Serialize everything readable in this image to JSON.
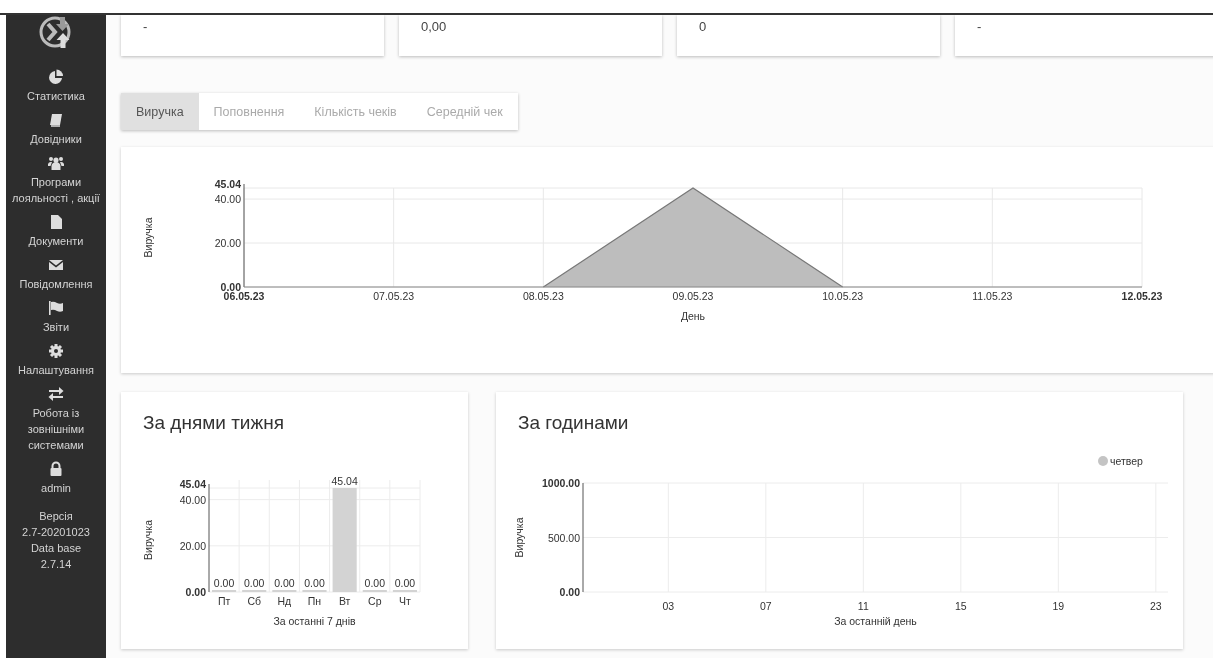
{
  "sidebar": {
    "items": [
      {
        "label": "Статистика"
      },
      {
        "label": "Довідники"
      },
      {
        "label": "Програми лояльності , акції"
      },
      {
        "label": "Документи"
      },
      {
        "label": "Повідомлення"
      },
      {
        "label": "Звіти"
      },
      {
        "label": "Налаштування"
      },
      {
        "label": "Робота із зовнішніми системами"
      },
      {
        "label": "admin"
      }
    ],
    "version_lines": [
      "Версія",
      "2.7-20201023",
      "Data base",
      "2.7.14"
    ]
  },
  "summary_cards": [
    {
      "value": "-"
    },
    {
      "value": "0,00"
    },
    {
      "value": "0"
    },
    {
      "value": "-"
    }
  ],
  "tabs": [
    {
      "label": "Виручка",
      "selected": true
    },
    {
      "label": "Поповнення",
      "selected": false
    },
    {
      "label": "Кількість чеків",
      "selected": false
    },
    {
      "label": "Середній чек",
      "selected": false
    }
  ],
  "revenue_chart": {
    "chart_data": {
      "type": "area",
      "xlabel": "День",
      "ylabel": "Виручка",
      "categories": [
        "06.05.23",
        "07.05.23",
        "08.05.23",
        "09.05.23",
        "10.05.23",
        "11.05.23",
        "12.05.23"
      ],
      "series": [
        {
          "color": "#bdbdbd",
          "values": [
            null,
            null,
            0,
            45.04,
            0,
            null,
            null
          ]
        }
      ],
      "grid": true,
      "ylim": [
        0,
        45.04
      ],
      "yticks": [
        {
          "value": 0,
          "label": "0.00"
        },
        {
          "value": 20,
          "label": "20.00"
        },
        {
          "value": 40,
          "label": "40.00"
        },
        {
          "value": 45.04,
          "label": "45.04"
        }
      ]
    }
  },
  "weekday_panel": {
    "title": "За днями тижня",
    "chart_data": {
      "type": "bar",
      "xlabel": "За останні 7 днів",
      "ylabel": "Виручка",
      "categories": [
        "Пт",
        "Сб",
        "Нд",
        "Пн",
        "Вт",
        "Ср",
        "Чт"
      ],
      "series": [
        {
          "color": "#d3d3d3",
          "values": [
            0,
            0,
            0,
            0,
            45.04,
            0,
            0
          ],
          "value_labels": [
            "0.00",
            "0.00",
            "0.00",
            "0.00",
            "45.04",
            "0.00",
            "0.00"
          ]
        }
      ],
      "grid": true,
      "ylim": [
        0,
        45.04
      ],
      "yticks": [
        {
          "value": 0,
          "label": "0.00"
        },
        {
          "value": 20,
          "label": "20.00"
        },
        {
          "value": 40,
          "label": "40.00"
        },
        {
          "value": 45.04,
          "label": "45.04"
        }
      ],
      "data_labels": true
    }
  },
  "hourly_panel": {
    "title": "За годинами",
    "chart_data": {
      "type": "line",
      "xlabel": "За останній день",
      "ylabel": "Виручка",
      "categories": [
        "03",
        "07",
        "11",
        "15",
        "19",
        "23"
      ],
      "series": [
        {
          "name": "четвер",
          "color": "#c4c4c4",
          "values": [
            null,
            null,
            null,
            null,
            null,
            null
          ]
        }
      ],
      "grid": true,
      "ylim": [
        0,
        1000
      ],
      "yticks": [
        {
          "value": 0,
          "label": "0.00"
        },
        {
          "value": 500,
          "label": "500.00"
        },
        {
          "value": 1000,
          "label": "1000.00"
        }
      ]
    }
  }
}
